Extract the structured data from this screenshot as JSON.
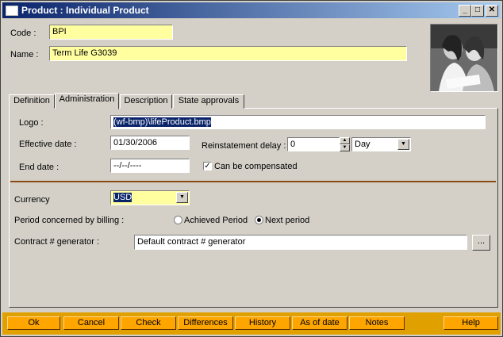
{
  "window": {
    "title": "Product : Individual Product",
    "controls": {
      "minimize": "_",
      "maximize": "□",
      "close": "✕"
    }
  },
  "header": {
    "code_label": "Code :",
    "code_value": "BPI",
    "name_label": "Name :",
    "name_value": "Term Life  G3039"
  },
  "tabs": [
    {
      "label": "Definition"
    },
    {
      "label": "Administration",
      "active": true
    },
    {
      "label": "Description"
    },
    {
      "label": "State approvals"
    }
  ],
  "admin": {
    "logo_label": "Logo :",
    "logo_value": "(wf-bmp)\\lifeProduct.bmp",
    "effective_label": "Effective date :",
    "effective_value": "01/30/2006",
    "end_label": "End date :",
    "end_value": "--/--/----",
    "reinstatement_label": "Reinstatement delay :",
    "reinstatement_value": "0",
    "reinstatement_unit": "Day",
    "compensated_label": "Can be compensated",
    "compensated_checked": true,
    "currency_label": "Currency",
    "currency_value": "USD",
    "billing_label": "Period concerned by billing :",
    "billing_options": [
      {
        "label": "Achieved Period",
        "selected": false
      },
      {
        "label": "Next period",
        "selected": true
      }
    ],
    "generator_label": "Contract # generator :",
    "generator_value": "Default contract # generator",
    "generator_button": "..."
  },
  "buttons": [
    "Ok",
    "Cancel",
    "Check",
    "Differences",
    "History",
    "As of date",
    "Notes",
    "Help"
  ],
  "colors": {
    "title_start": "#0a246a",
    "field_yellow": "#ffffa0",
    "button_orange": "#ffa500",
    "separator": "#8b4a12"
  }
}
